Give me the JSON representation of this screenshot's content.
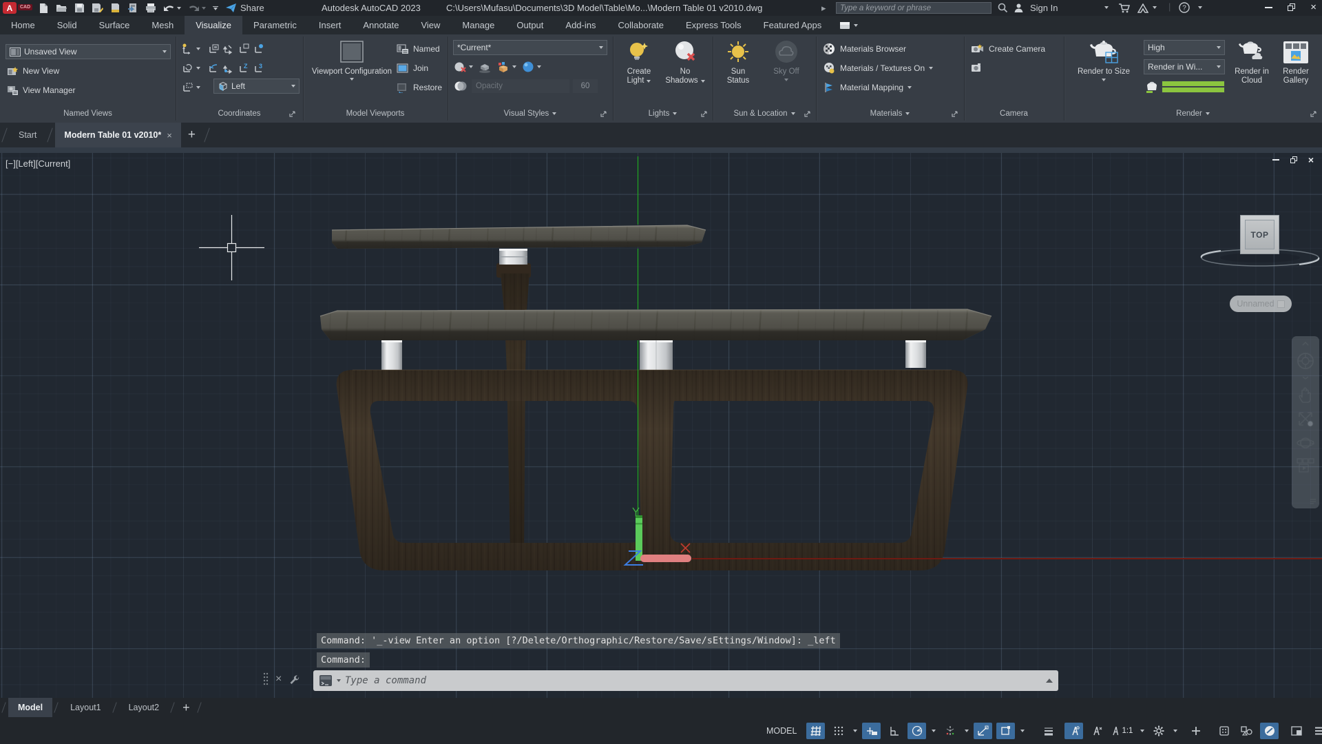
{
  "title_bar": {
    "app_title": "Autodesk AutoCAD 2023",
    "doc_path": "C:\\Users\\Mufasu\\Documents\\3D Model\\Table\\Mo...\\Modern Table 01 v2010.dwg",
    "share_label": "Share",
    "search_placeholder": "Type a keyword or phrase",
    "sign_in_label": "Sign In"
  },
  "ribbon": {
    "tabs": [
      "Home",
      "Solid",
      "Surface",
      "Mesh",
      "Visualize",
      "Parametric",
      "Insert",
      "Annotate",
      "View",
      "Manage",
      "Output",
      "Add-ins",
      "Collaborate",
      "Express Tools",
      "Featured Apps"
    ],
    "active_tab": "Visualize",
    "named_views": {
      "dropdown_value": "Unsaved View",
      "new_view": "New View",
      "view_manager": "View Manager",
      "label": "Named Views"
    },
    "coordinates": {
      "left_value": "Left",
      "label": "Coordinates",
      "z_glyph": "Z",
      "three_glyph": "3"
    },
    "model_viewports": {
      "viewport_config": "Viewport Configuration",
      "named": "Named",
      "join": "Join",
      "restore": "Restore",
      "label": "Model Viewports"
    },
    "visual_styles": {
      "dropdown_value": "*Current*",
      "opacity_label": "Opacity",
      "opacity_value": "60",
      "label": "Visual Styles"
    },
    "lights": {
      "create_light_1": "Create",
      "create_light_2": "Light",
      "no_shadows_1": "No",
      "no_shadows_2": "Shadows",
      "label": "Lights"
    },
    "sun_location": {
      "sun_status_1": "Sun",
      "sun_status_2": "Status",
      "sky_off": "Sky Off",
      "label": "Sun & Location"
    },
    "materials": {
      "browser": "Materials Browser",
      "textures_on": "Materials / Textures On",
      "mapping": "Material Mapping",
      "label": "Materials"
    },
    "camera": {
      "create_camera": "Create Camera",
      "label": "Camera"
    },
    "render": {
      "render_to_size": "Render to Size",
      "quality_value": "High",
      "target_value": "Render in Wi...",
      "render_in_cloud_1": "Render in",
      "render_in_cloud_2": "Cloud",
      "render_gallery_1": "Render",
      "render_gallery_2": "Gallery",
      "label": "Render"
    }
  },
  "file_tabs": {
    "start": "Start",
    "active_doc": "Modern Table 01 v2010*"
  },
  "viewport": {
    "label": "[−][Left][Current]",
    "viewcube_face": "TOP",
    "unnamed_label": "Unnamed",
    "command_history_1": "Command: '_-view Enter an option [?/Delete/Orthographic/Restore/Save/sEttings/Window]: _left",
    "command_history_2": "Command:",
    "command_placeholder": "Type a command",
    "ucs": {
      "x": "X",
      "y": "Y",
      "z": "Z"
    }
  },
  "layout_tabs": {
    "model": "Model",
    "layout1": "Layout1",
    "layout2": "Layout2"
  },
  "status_bar": {
    "model_label": "MODEL",
    "annotation_scale": "1:1"
  },
  "colors": {
    "accent_blue": "#3b6c9d",
    "highlight_green": "#8bc53f",
    "axis_green": "#3fae3f",
    "axis_red": "#c23b30",
    "axis_blue": "#3d7de0"
  }
}
